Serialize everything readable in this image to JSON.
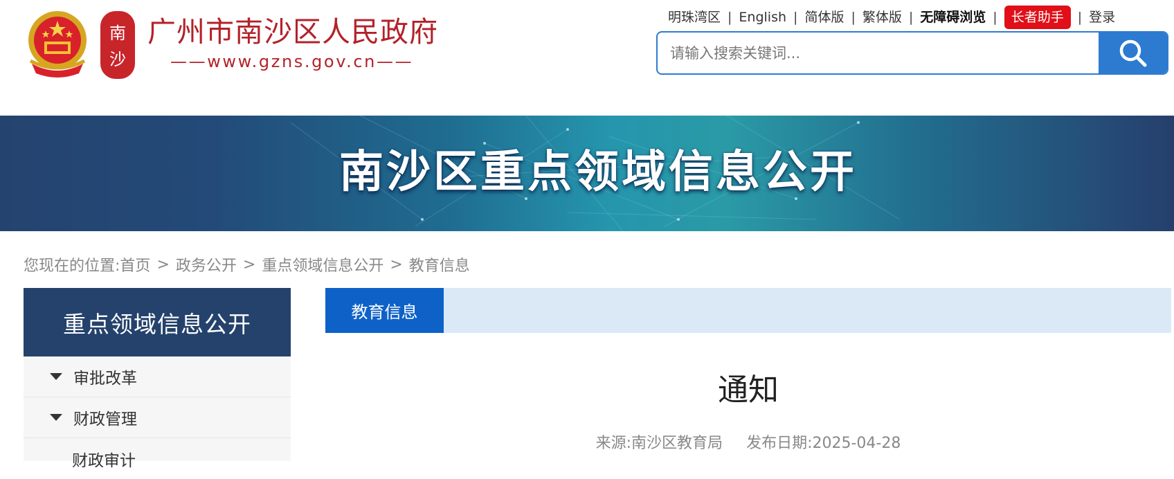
{
  "header": {
    "site_title": "广州市南沙区人民政府",
    "site_url": "——www.gzns.gov.cn——",
    "seal_text": "南沙",
    "top_nav": [
      {
        "label": "明珠湾区"
      },
      {
        "label": "English"
      },
      {
        "label": "简体版"
      },
      {
        "label": "繁体版"
      },
      {
        "label": "无障碍浏览"
      },
      {
        "label": "长者助手"
      },
      {
        "label": "登录"
      }
    ],
    "separator": "|",
    "search": {
      "placeholder": "请输入搜索关键词...",
      "value": "",
      "button_icon": "search-icon"
    }
  },
  "banner": {
    "title": "南沙区重点领域信息公开"
  },
  "breadcrumb": {
    "prefix": "您现在的位置:",
    "items": [
      "首页",
      "政务公开",
      "重点领域信息公开",
      "教育信息"
    ],
    "separator": ">"
  },
  "sidebar": {
    "title": "重点领域信息公开",
    "items": [
      {
        "label": "审批改革",
        "expandable": true
      },
      {
        "label": "财政管理",
        "expandable": true
      },
      {
        "label": "财政审计",
        "expandable": false
      }
    ]
  },
  "main": {
    "tab": "教育信息",
    "article": {
      "title": "通知",
      "source_label": "来源:南沙区教育局",
      "date_label": "发布日期:2025-04-28"
    }
  },
  "colors": {
    "brand_red": "#b3222a",
    "accent_blue": "#2d7bd0",
    "tab_blue": "#0e62c7",
    "sidebar_navy": "#24426b",
    "elder_red": "#e00f18"
  }
}
